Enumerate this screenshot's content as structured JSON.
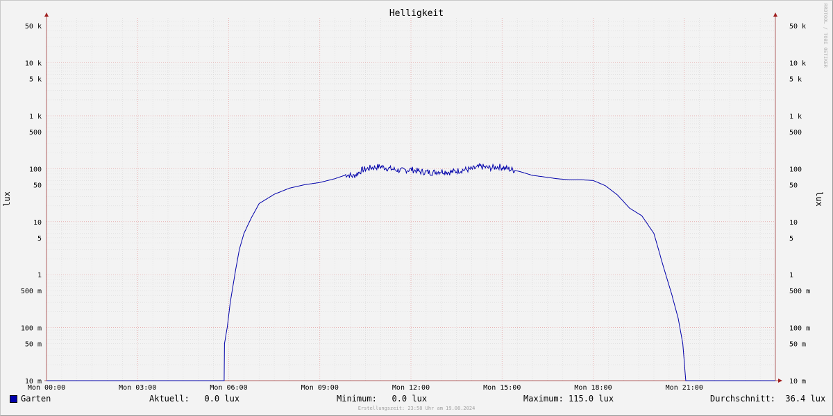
{
  "chart_data": {
    "type": "line",
    "title": "Helligkeit",
    "ylabel": "lux",
    "yscale": "log",
    "ylim": [
      0.01,
      70000
    ],
    "xlim": [
      0,
      24
    ],
    "grid": true,
    "y_ticks": [
      {
        "value": 50000,
        "label": "50 k"
      },
      {
        "value": 10000,
        "label": "10 k"
      },
      {
        "value": 5000,
        "label": "5 k"
      },
      {
        "value": 1000,
        "label": "1 k"
      },
      {
        "value": 500,
        "label": "500"
      },
      {
        "value": 100,
        "label": "100"
      },
      {
        "value": 50,
        "label": "50"
      },
      {
        "value": 10,
        "label": "10"
      },
      {
        "value": 5,
        "label": "5"
      },
      {
        "value": 1,
        "label": "1"
      },
      {
        "value": 0.5,
        "label": "500 m"
      },
      {
        "value": 0.1,
        "label": "100 m"
      },
      {
        "value": 0.05,
        "label": "50 m"
      },
      {
        "value": 0.01,
        "label": "10 m"
      }
    ],
    "x_ticks": [
      {
        "value": 0,
        "label": "Mon 00:00"
      },
      {
        "value": 3,
        "label": "Mon 03:00"
      },
      {
        "value": 6,
        "label": "Mon 06:00"
      },
      {
        "value": 9,
        "label": "Mon 09:00"
      },
      {
        "value": 12,
        "label": "Mon 12:00"
      },
      {
        "value": 15,
        "label": "Mon 15:00"
      },
      {
        "value": 18,
        "label": "Mon 18:00"
      },
      {
        "value": 21,
        "label": "Mon 21:00"
      }
    ],
    "series": [
      {
        "name": "Garten",
        "color": "#0000aa",
        "x": [
          0,
          5.85,
          5.86,
          5.95,
          6.05,
          6.2,
          6.35,
          6.5,
          6.75,
          7.0,
          7.5,
          8.0,
          8.5,
          9.0,
          9.5,
          9.9,
          10.1,
          10.4,
          10.7,
          11.0,
          11.3,
          11.7,
          12.0,
          12.3,
          12.7,
          13.0,
          13.3,
          13.7,
          14.0,
          14.3,
          14.6,
          14.9,
          15.2,
          15.6,
          16.0,
          16.4,
          16.8,
          17.2,
          17.6,
          18.0,
          18.4,
          18.8,
          19.2,
          19.6,
          20.0,
          20.3,
          20.6,
          20.8,
          20.95,
          21.05,
          21.1,
          21.15,
          21.2,
          21.3,
          22,
          24
        ],
        "values": [
          0.01,
          0.01,
          0.05,
          0.1,
          0.3,
          1,
          3,
          6,
          12,
          22,
          33,
          43,
          50,
          55,
          65,
          78,
          72,
          95,
          105,
          110,
          100,
          92,
          97,
          88,
          85,
          90,
          86,
          95,
          98,
          110,
          103,
          110,
          100,
          88,
          75,
          70,
          65,
          62,
          62,
          60,
          48,
          32,
          18,
          13,
          6,
          1.5,
          0.4,
          0.15,
          0.05,
          0.01,
          0.01,
          0.01,
          0.01,
          0.01,
          0.01,
          0.01
        ]
      }
    ]
  },
  "watermark": "RRDTOOL / TOBI OETIKER",
  "legend": {
    "series_name": "Garten",
    "current": "Aktuell:   0.0 lux",
    "minimum": "Minimum:   0.0 lux",
    "maximum": "Maximum: 115.0 lux",
    "average": "Durchschnitt:  36.4 lux"
  },
  "footer": "Erstellungszeit: 23:58 Uhr am 19.08.2024"
}
